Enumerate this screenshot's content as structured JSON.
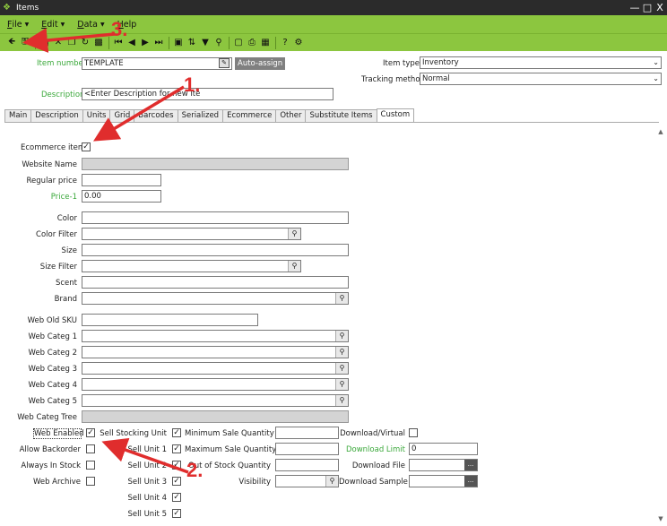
{
  "window": {
    "title": "Items",
    "minimize": "—",
    "restore": "□",
    "close": "X"
  },
  "menu": [
    {
      "label": "File",
      "key": "F",
      "rest": "ile"
    },
    {
      "label": "Edit",
      "key": "E",
      "rest": "dit"
    },
    {
      "label": "Data",
      "key": "D",
      "rest": "ata"
    },
    {
      "label": "Help",
      "key": "H",
      "rest": "elp"
    }
  ],
  "toolbar": {
    "icons": [
      "back-icon",
      "save-icon",
      "print-save-icon",
      "delete-icon",
      "copy-icon",
      "refresh-icon",
      "save-as-icon",
      "first-record-icon",
      "previous-record-icon",
      "next-record-icon",
      "last-record-icon",
      "layout-icon",
      "sort-icon",
      "filter-icon",
      "search-icon",
      "notes-icon",
      "print-icon",
      "grid-icon",
      "help-icon",
      "settings-icon"
    ]
  },
  "header": {
    "item_number_label": "Item number",
    "item_number_value": "TEMPLATE",
    "auto_assign_label": "Auto-assign",
    "description_label": "Description",
    "description_value": "<Enter Description for new ite",
    "item_type_label": "Item type",
    "item_type_value": "Inventory",
    "tracking_method_label": "Tracking method",
    "tracking_method_value": "Normal"
  },
  "tabs": [
    {
      "label": "Main",
      "active": false
    },
    {
      "label": "Description",
      "active": false
    },
    {
      "label": "Units",
      "active": false
    },
    {
      "label": "Grid",
      "active": false
    },
    {
      "label": "Barcodes",
      "active": false
    },
    {
      "label": "Serialized",
      "active": false
    },
    {
      "label": "Ecommerce",
      "active": false
    },
    {
      "label": "Other",
      "active": false
    },
    {
      "label": "Substitute Items",
      "active": false
    },
    {
      "label": "Custom",
      "active": true
    }
  ],
  "custom": {
    "ecommerce_item_label": "Ecommerce item",
    "ecommerce_item_checked": "✓",
    "website_name_label": "Website Name",
    "regular_price_label": "Regular price",
    "price1_label": "Price-1",
    "price1_value": "0.00",
    "color_label": "Color",
    "color_filter_label": "Color Filter",
    "size_label": "Size",
    "size_filter_label": "Size Filter",
    "scent_label": "Scent",
    "brand_label": "Brand",
    "web_old_sku_label": "Web Old SKU",
    "web_categ_1_label": "Web Categ 1",
    "web_categ_2_label": "Web Categ 2",
    "web_categ_3_label": "Web Categ 3",
    "web_categ_4_label": "Web Categ 4",
    "web_categ_5_label": "Web Categ 5",
    "web_categ_tree_label": "Web Categ Tree",
    "web_enabled_label": "Web Enabled",
    "web_enabled_checked": "✓",
    "allow_backorder_label": "Allow Backorder",
    "always_in_stock_label": "Always In Stock",
    "web_archive_label": "Web Archive",
    "sell_stocking_unit_label": "Sell Stocking Unit",
    "sell_unit_1_label": "Sell Unit 1",
    "sell_unit_2_label": "Sell Unit 2",
    "sell_unit_3_label": "Sell Unit 3",
    "sell_unit_4_label": "Sell Unit 4",
    "sell_unit_5_label": "Sell Unit 5",
    "check_mark": "✓",
    "min_sale_qty_label": "Minimum Sale Quantity",
    "max_sale_qty_label": "Maximum Sale Quantity",
    "out_of_stock_qty_label": "Out of Stock Quantity",
    "visibility_label": "Visibility",
    "download_virtual_label": "Download/Virtual",
    "download_limit_label": "Download Limit",
    "download_limit_value": "0",
    "download_file_label": "Download File",
    "download_sample_label": "Download Sample",
    "ellipsis": "..."
  },
  "annotations": {
    "one": "1.",
    "two": "2.",
    "three": "3."
  },
  "colors": {
    "menu_green": "#8cc63f",
    "label_green": "#3aa83a",
    "annotation_red": "#e02d2d"
  }
}
